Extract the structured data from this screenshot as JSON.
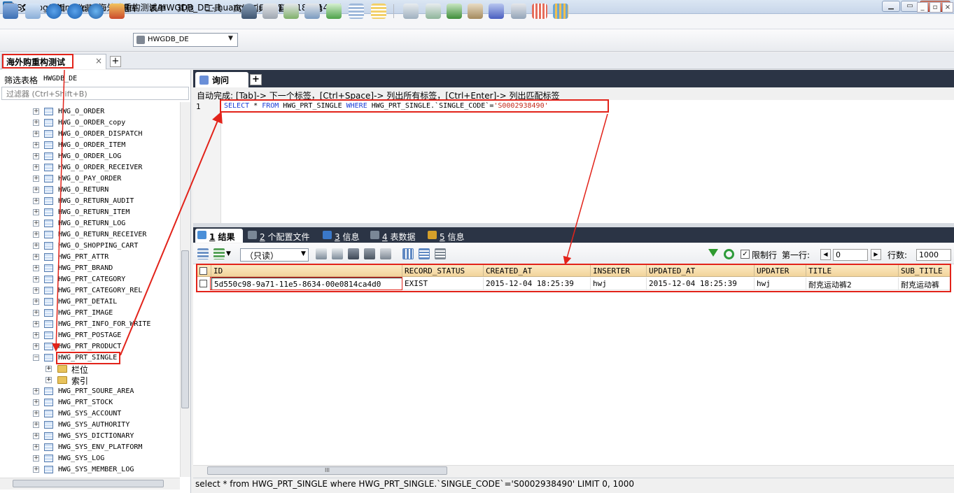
{
  "window": {
    "title": "SQLyog Ultimate - [海外购重构测试/HWGDB_DE - huangwujun@172.18.1.149*]"
  },
  "menu": [
    "文件",
    "编辑",
    "收藏夹",
    "数据库",
    "表单",
    "其他",
    "工具",
    "高级工具",
    "窗口",
    "帮助"
  ],
  "toolbar": {
    "database_select": "HWGDB_DE"
  },
  "connection_tab": {
    "label": "海外购重构测试",
    "close": "×",
    "add": "+"
  },
  "left_panel": {
    "filter_label": "筛选表格",
    "filter_db": "HWGDB_DE",
    "filter_placeholder": "过滤器 (Ctrl+Shift+B)",
    "tables_before": [
      "HWG_O_ORDER",
      "HWG_O_ORDER_copy",
      "HWG_O_ORDER_DISPATCH",
      "HWG_O_ORDER_ITEM",
      "HWG_O_ORDER_LOG",
      "HWG_O_ORDER_RECEIVER",
      "HWG_O_PAY_ORDER",
      "HWG_O_RETURN",
      "HWG_O_RETURN_AUDIT",
      "HWG_O_RETURN_ITEM",
      "HWG_O_RETURN_LOG",
      "HWG_O_RETURN_RECEIVER",
      "HWG_O_SHOPPING_CART",
      "HWG_PRT_ATTR",
      "HWG_PRT_BRAND",
      "HWG_PRT_CATEGORY",
      "HWG_PRT_CATEGORY_REL",
      "HWG_PRT_DETAIL",
      "HWG_PRT_IMAGE",
      "HWG_PRT_INFO_FOR_WRITE",
      "HWG_PRT_POSTAGE",
      "HWG_PRT_PRODUCT"
    ],
    "selected_table": "HWG_PRT_SINGLE",
    "selected_children": [
      "栏位",
      "索引"
    ],
    "tables_after": [
      "HWG_PRT_SOURE_AREA",
      "HWG_PRT_STOCK",
      "HWG_SYS_ACCOUNT",
      "HWG_SYS_AUTHORITY",
      "HWG_SYS_DICTIONARY",
      "HWG_SYS_ENV_PLATFORM",
      "HWG_SYS_LOG",
      "HWG_SYS_MEMBER_LOG"
    ],
    "expand_plus": "+",
    "expand_minus": "−"
  },
  "query": {
    "tab_label": "询问",
    "tab_add": "+",
    "autocomplete_hint": "自动完成: [Tab]-> 下一个标签，[Ctrl+Space]-> 列出所有标签，[Ctrl+Enter]-> 列出匹配标签",
    "line_number": "1",
    "sql_parts": {
      "k1": "SELECT",
      "t1": " * ",
      "k2": "FROM",
      "t2": " HWG_PRT_SINGLE ",
      "k3": "WHERE",
      "t3": " HWG_PRT_SINGLE.`SINGLE_CODE`=",
      "s1": "'S0002938490'"
    }
  },
  "result_tabs": [
    {
      "num": "1",
      "label": "结果",
      "icon_color": "#4a8fd8"
    },
    {
      "num": "2",
      "label": "个配置文件",
      "icon_color": "#7a8796"
    },
    {
      "num": "3",
      "label": "信息",
      "icon_color": "#3a78c9"
    },
    {
      "num": "4",
      "label": "表数据",
      "icon_color": "#7a8796"
    },
    {
      "num": "5",
      "label": "信息",
      "icon_color": "#d6a02a"
    }
  ],
  "result_toolbar": {
    "readonly_label": "（只读）",
    "limit_rows_label": "限制行",
    "limit_checked": "✓",
    "first_row_label": "第一行:",
    "first_row_value": "0",
    "rows_label": "行数:",
    "rows_value": "1000",
    "prev": "◀",
    "next": "▶"
  },
  "grid": {
    "columns": [
      "ID",
      "RECORD_STATUS",
      "CREATED_AT",
      "INSERTER",
      "UPDATED_AT",
      "UPDATER",
      "TITLE",
      "SUB_TITLE"
    ],
    "rows": [
      [
        "5d550c98-9a71-11e5-8634-00e0814ca4d0",
        "EXIST",
        "2015-12-04 18:25:39",
        "hwj",
        "2015-12-04 18:25:39",
        "hwj",
        "耐克运动裤2",
        "耐克运动裤"
      ]
    ],
    "hscroll_glyph": "III"
  },
  "status_bar": {
    "text": "select * from HWG_PRT_SINGLE where HWG_PRT_SINGLE.`SINGLE_CODE`='S0002938490' LIMIT 0, 1000"
  },
  "colors": {
    "annotation_red": "#e2231a",
    "keyword_blue": "#1b3fd6",
    "dark_tabbar": "#2b3445"
  }
}
